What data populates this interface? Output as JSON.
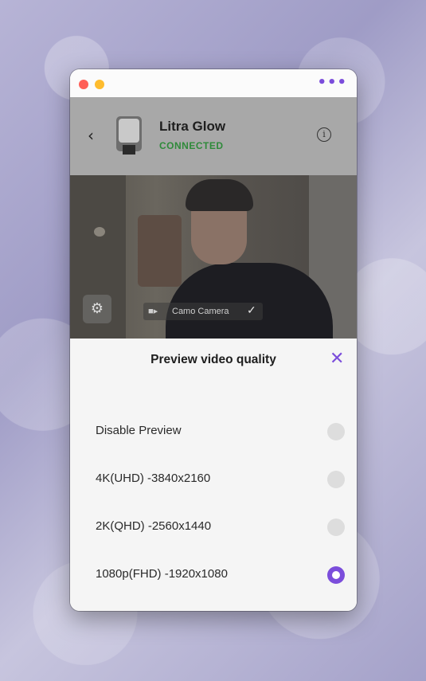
{
  "header": {
    "device_name": "Litra Glow",
    "device_status": "CONNECTED",
    "back_glyph": "‹",
    "info_glyph": "i"
  },
  "preview": {
    "camera_label": "Camo Camera"
  },
  "sheet": {
    "title": "Preview video quality",
    "close_glyph": "✕",
    "options": [
      {
        "label": "Disable Preview",
        "selected": false
      },
      {
        "label": "4K(UHD) -3840x2160",
        "selected": false
      },
      {
        "label": "2K(QHD) -2560x1440",
        "selected": false
      },
      {
        "label": "1080p(FHD) -1920x1080",
        "selected": true
      }
    ]
  },
  "colors": {
    "accent": "#7b4ddb",
    "connected": "#2f8a3a"
  },
  "icons": [
    "more-dots-icon",
    "back-chevron-icon",
    "info-icon",
    "settings-gear-icon",
    "video-camera-icon",
    "close-icon"
  ]
}
